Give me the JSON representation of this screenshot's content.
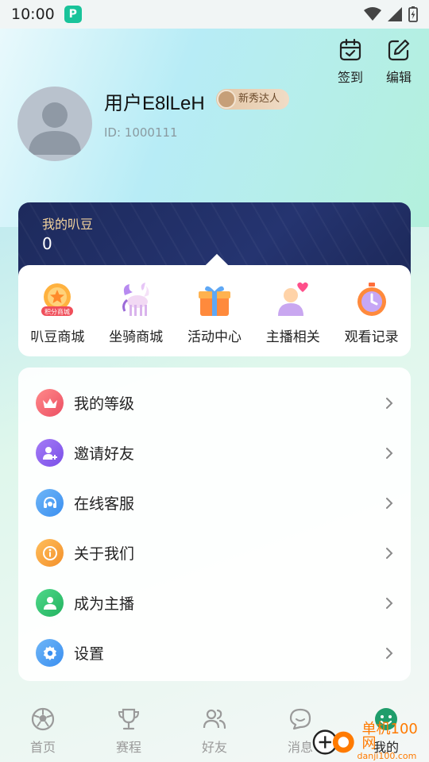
{
  "status_bar": {
    "time": "10:00",
    "app_icon": "P"
  },
  "header": {
    "checkin_label": "签到",
    "edit_label": "编辑"
  },
  "profile": {
    "username": "用户E8lLeH",
    "badge": "新秀达人",
    "user_id": "ID: 1000111"
  },
  "beans": {
    "label": "我的叭豆",
    "value": "0"
  },
  "shortcuts": [
    {
      "label": "叭豆商城",
      "icon": "bean-mall-icon",
      "icon_text": "积分商城"
    },
    {
      "label": "坐骑商城",
      "icon": "mount-horse-icon"
    },
    {
      "label": "活动中心",
      "icon": "gift-box-icon"
    },
    {
      "label": "主播相关",
      "icon": "streamer-heart-icon"
    },
    {
      "label": "观看记录",
      "icon": "stopwatch-icon"
    }
  ],
  "menu": [
    {
      "label": "我的等级",
      "icon": "crown-icon",
      "color": "#f06272"
    },
    {
      "label": "邀请好友",
      "icon": "invite-user-icon",
      "color": "#8a5cf0"
    },
    {
      "label": "在线客服",
      "icon": "headset-icon",
      "color": "#3f9bf0"
    },
    {
      "label": "关于我们",
      "icon": "info-icon",
      "color": "#f5a03a"
    },
    {
      "label": "成为主播",
      "icon": "user-icon",
      "color": "#2dbf6a"
    },
    {
      "label": "设置",
      "icon": "settings-gear-icon",
      "color": "#3f9bf0"
    }
  ],
  "tabbar": [
    {
      "label": "首页",
      "icon": "soccer-ball-icon"
    },
    {
      "label": "赛程",
      "icon": "trophy-icon"
    },
    {
      "label": "好友",
      "icon": "friends-icon"
    },
    {
      "label": "消息",
      "icon": "message-icon"
    },
    {
      "label": "我的",
      "icon": "smiley-icon",
      "active": true
    }
  ],
  "watermark": {
    "text": "单机100网",
    "sub": "danji100.com"
  }
}
